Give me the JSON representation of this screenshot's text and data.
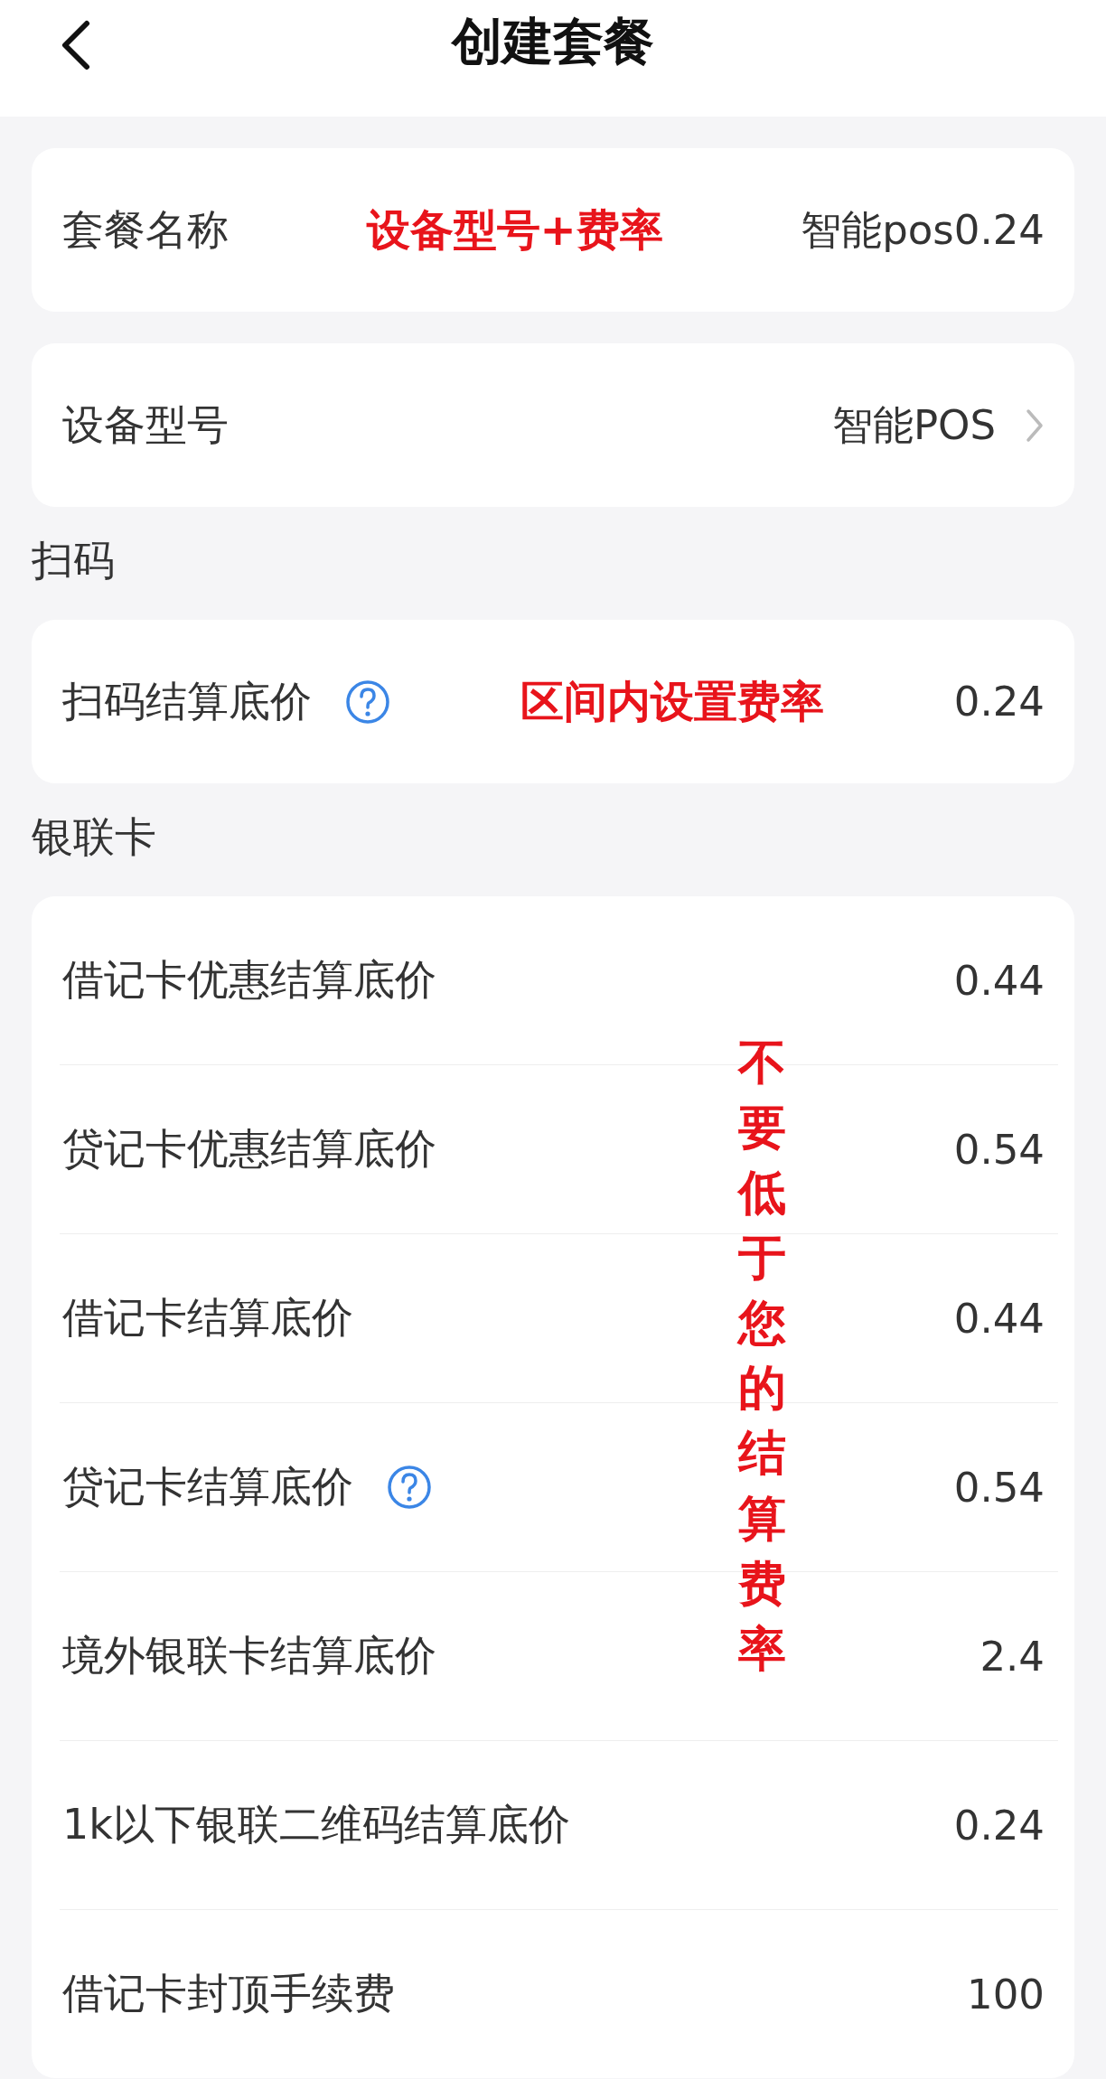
{
  "header": {
    "title": "创建套餐"
  },
  "blocks": [
    {
      "kind": "card",
      "rows": [
        {
          "label": "套餐名称",
          "value": "智能pos0.24",
          "note": "设备型号+费率",
          "help": false,
          "chevron": false
        }
      ]
    },
    {
      "kind": "card",
      "rows": [
        {
          "label": "设备型号",
          "value": "智能POS",
          "help": false,
          "chevron": true
        }
      ]
    },
    {
      "kind": "heading",
      "text": "扫码"
    },
    {
      "kind": "card",
      "rows": [
        {
          "label": "扫码结算底价",
          "value": "0.24",
          "note": "区间内设置费率",
          "help": true,
          "chevron": false
        }
      ]
    },
    {
      "kind": "heading",
      "text": "银联卡"
    },
    {
      "kind": "card",
      "overlay_note": "不要低于您的结算费率",
      "rows": [
        {
          "label": "借记卡优惠结算底价",
          "value": "0.44",
          "help": false,
          "chevron": false
        },
        {
          "label": "贷记卡优惠结算底价",
          "value": "0.54",
          "help": false,
          "chevron": false
        },
        {
          "label": "借记卡结算底价",
          "value": "0.44",
          "help": false,
          "chevron": false
        },
        {
          "label": "贷记卡结算底价",
          "value": "0.54",
          "help": true,
          "chevron": false
        },
        {
          "label": "境外银联卡结算底价",
          "value": "2.4",
          "help": false,
          "chevron": false
        },
        {
          "label": "1k以下银联二维码结算底价",
          "value": "0.24",
          "help": false,
          "chevron": false
        },
        {
          "label": "借记卡封顶手续费",
          "value": "100",
          "help": false,
          "chevron": false
        }
      ]
    }
  ]
}
